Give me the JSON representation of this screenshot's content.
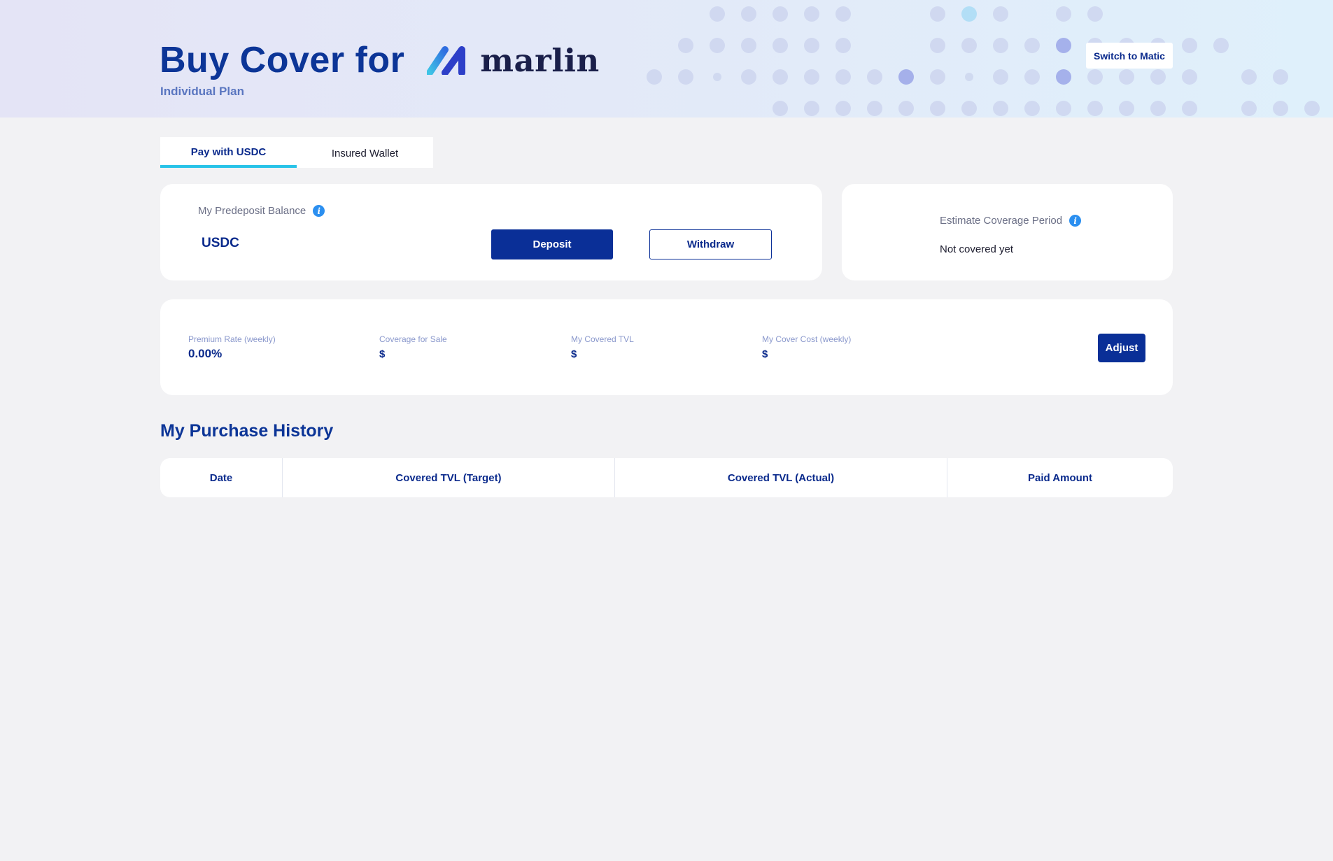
{
  "header": {
    "title": "Buy Cover for",
    "brand": "marlin",
    "subtitle": "Individual Plan",
    "switch_label": "Switch to Matic"
  },
  "tabs": [
    {
      "label": "Pay with USDC",
      "active": true
    },
    {
      "label": "Insured Wallet",
      "active": false
    }
  ],
  "balance": {
    "label": "My Predeposit Balance",
    "value": "USDC",
    "deposit_label": "Deposit",
    "withdraw_label": "Withdraw"
  },
  "coverage": {
    "label": "Estimate Coverage Period",
    "value": "Not covered yet"
  },
  "stats": {
    "premium_rate": {
      "label": "Premium Rate (weekly)",
      "value": "0.00%"
    },
    "coverage_for_sale": {
      "label": "Coverage for Sale",
      "value": "$"
    },
    "covered_tvl": {
      "label": "My Covered TVL",
      "value": "$"
    },
    "cover_cost": {
      "label": "My Cover Cost (weekly)",
      "value": "$"
    },
    "adjust_label": "Adjust"
  },
  "history": {
    "title": "My Purchase History",
    "columns": [
      "Date",
      "Covered TVL (Target)",
      "Covered TVL (Actual)",
      "Paid Amount"
    ]
  },
  "colors": {
    "primary": "#0a2f97",
    "tab_accent": "#29c3e8",
    "info": "#2b8ff0",
    "background": "#f2f2f4"
  }
}
